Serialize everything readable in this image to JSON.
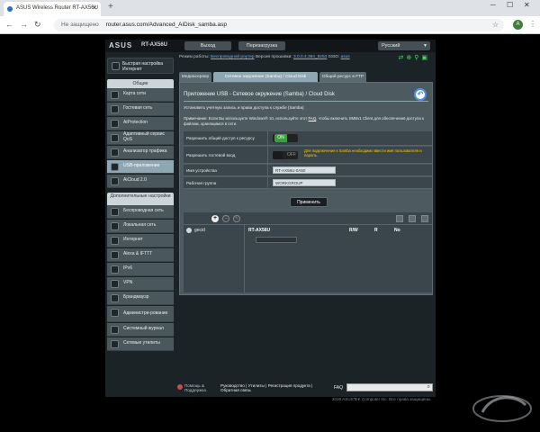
{
  "browser": {
    "tab_title": "ASUS Wireless Router RT-AX56U",
    "new_tab": "+",
    "not_secure": "Не защищено",
    "url": "router.asus.com/Advanced_AiDisk_samba.asp",
    "avatar": "A"
  },
  "header": {
    "logo": "ASUS",
    "model": "RT-AX56U",
    "logout": "Выход",
    "reboot": "Перезагрузка",
    "language": "Русский"
  },
  "status": {
    "mode_label": "Режим работы:",
    "mode_value": "Беспроводной роутер",
    "firmware_label": "Версия прошивки:",
    "firmware_value": "3.0.0.4.384_8253",
    "ssid_label": "SSID:",
    "ssid_value": "asus"
  },
  "sidebar": {
    "quick_setup": "Быстрая настройка Интернет",
    "general_header": "Общие",
    "general_items": [
      "Карта сети",
      "Гостевая сеть",
      "AiProtection",
      "Адаптивный сервис QoS",
      "Анализатор трафика",
      "USB-приложение",
      "AiCloud 2.0"
    ],
    "advanced_header": "Дополнительные настройки",
    "advanced_items": [
      "Беспроводная сеть",
      "Локальная сеть",
      "Интернет",
      "Alexa & IFTTT",
      "IPv6",
      "VPN",
      "Брандмауэр",
      "Администри-рование",
      "Системный журнал",
      "Сетевые утилиты"
    ]
  },
  "tabs": [
    "Медиасервер",
    "Сетевое окружение (Samba) / Cloud Disk",
    "Общий ресурс в FTP"
  ],
  "panel": {
    "title": "Приложение USB - Сетевое окружение (Samba) / Cloud Disk",
    "description": "Установить учетную запись и права доступа к службе (Samba)",
    "note_pre": "Примечание: Если Вы используете Windows® 10, используйте этот ",
    "note_link": "FAQ",
    "note_post": ", чтобы включить SMBv1 Client для обеспечения доступа к файлам, хранящимся в сети.",
    "rows": {
      "share_label": "Разрешить общий доступ к ресурсу",
      "share_state": "ON",
      "guest_label": "Разрешить гостевой вход",
      "guest_state": "OFF",
      "guest_warning": "Для подключения к Samba необходимо ввести имя пользователя и пароль.",
      "device_label": "Имя устройства",
      "device_value": "RT-AX56U-0A50",
      "workgroup_label": "Рабочая группа",
      "workgroup_value": "WORKGROUP"
    },
    "apply": "Применить",
    "user": "gecid",
    "device": "RT-AX56U",
    "col_rw": "R/W",
    "col_r": "R",
    "col_no": "No"
  },
  "footer": {
    "help": "Помощь & Поддержка",
    "links": "Руководство | Утилиты | Регистрация продукта | Обратная связь",
    "faq": "FAQ",
    "copyright": "2020 ASUSTeK Computer Inc. Все права защищены."
  }
}
